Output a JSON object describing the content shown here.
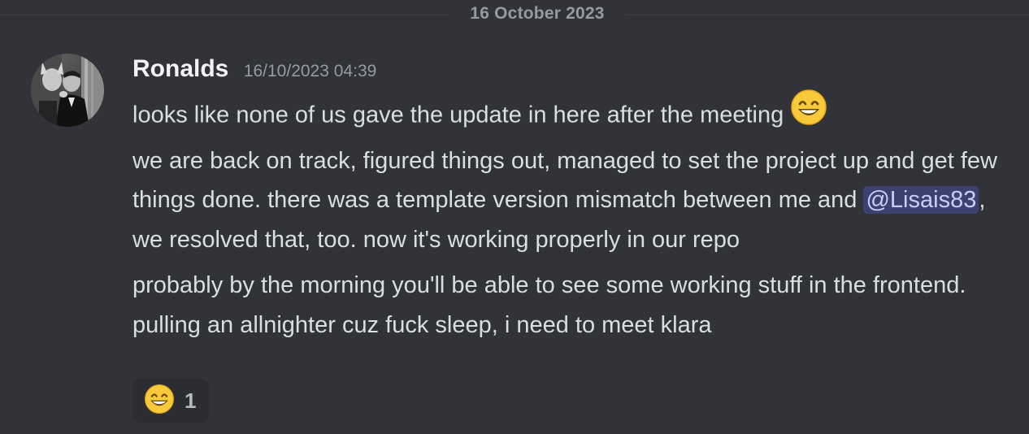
{
  "divider": {
    "date": "16 October 2023"
  },
  "message": {
    "author": "Ronalds",
    "timestamp": "16/10/2023 04:39",
    "line1": "looks like none of us gave the update in here after the meeting",
    "line2_before": "we are back on track, figured things out, managed to set the project up and get few things done. there was a template version mismatch between me and ",
    "mention": "@Lisais83",
    "line2_after": ", we resolved that, too. now it's working properly in our repo",
    "line3": "probably by the morning you'll be able to see some working stuff in the frontend. pulling an allnighter cuz fuck sleep, i need to meet klara",
    "inline_emoji": "grinning-smiling-eyes-emoji"
  },
  "reactions": [
    {
      "emoji": "grinning-smiling-eyes-emoji",
      "count": "1"
    }
  ],
  "colors": {
    "background": "#313338",
    "text": "#dbdee1",
    "username": "#f2f3f5",
    "muted": "#949ba4",
    "mention_bg": "#3c4270",
    "mention_text": "#c9cdfb",
    "reaction_bg": "#2b2d31"
  }
}
